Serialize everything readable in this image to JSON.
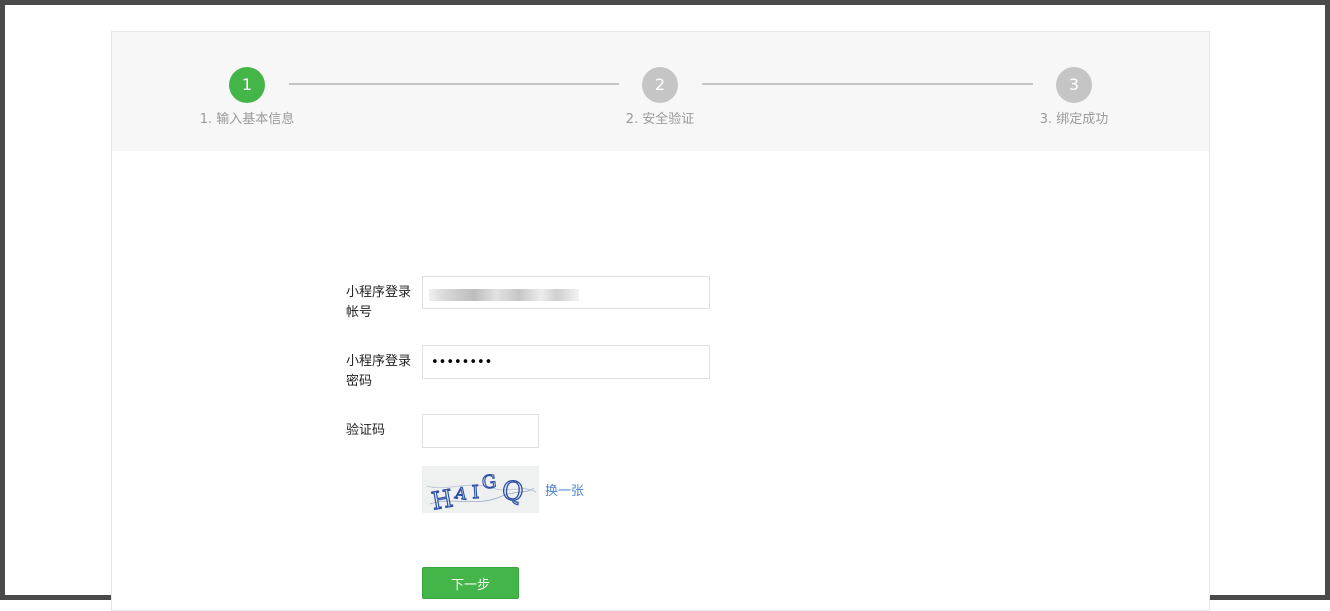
{
  "steps": [
    {
      "number": "1",
      "label": "1. 输入基本信息",
      "state": "active"
    },
    {
      "number": "2",
      "label": "2. 安全验证",
      "state": "inactive"
    },
    {
      "number": "3",
      "label": "3. 绑定成功",
      "state": "inactive"
    }
  ],
  "form": {
    "account_label": "小程序登录帐号",
    "password_label": "小程序登录密码",
    "password_value": "••••••••",
    "captcha_label": "验证码",
    "captcha_value": "",
    "captcha_text": "HAIGQ",
    "refresh_label": "换一张",
    "next_label": "下一步"
  },
  "colors": {
    "accent": "#44b549",
    "step_inactive": "#c5c5c5",
    "link": "#4d84d2"
  }
}
